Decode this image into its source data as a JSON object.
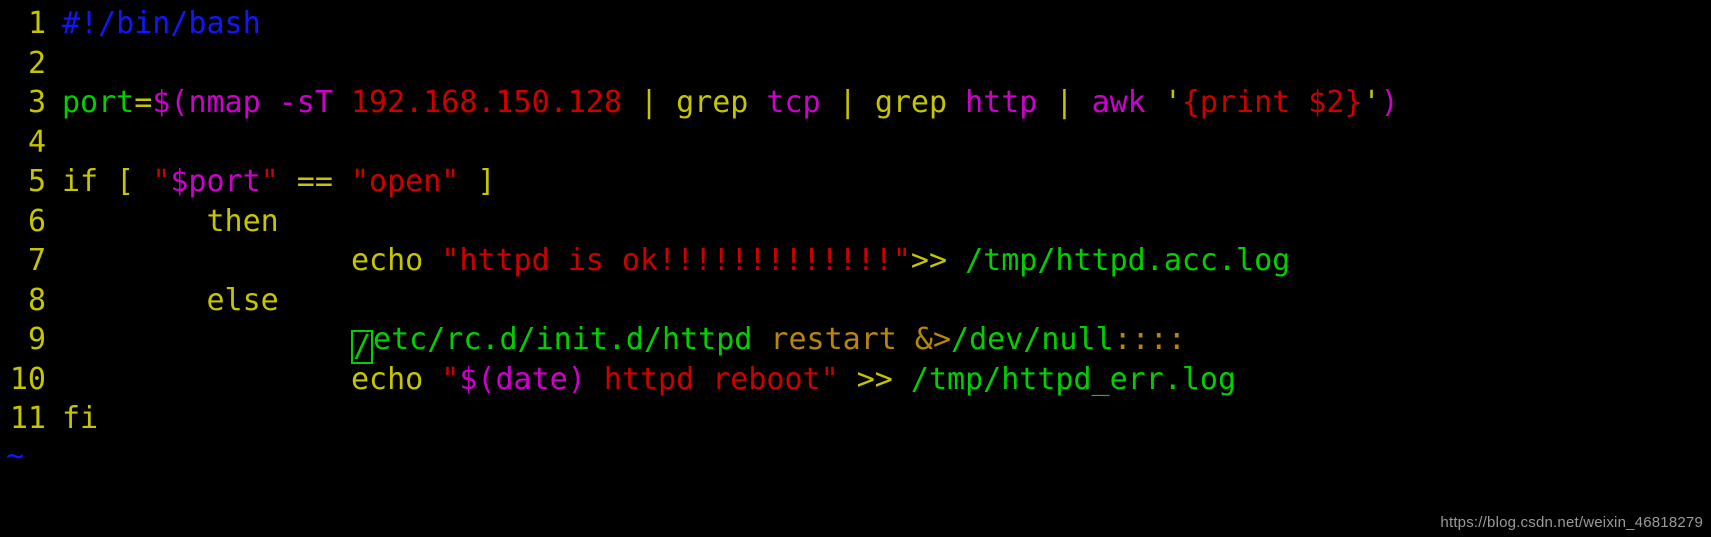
{
  "editor": {
    "name": "vim",
    "background_color": "#000000",
    "line_number_color": "#c5c500",
    "tilde_marker": "~",
    "cursor": {
      "style": "hollow-block",
      "color": "#00d000",
      "line": 9,
      "column": 1,
      "character": "/"
    }
  },
  "colors": {
    "comment_blue": "#1414ff",
    "keyword_yellow": "#c5c500",
    "variable_magenta": "#cd00cd",
    "string_red": "#cd0000",
    "path_green": "#00d000",
    "olive": "#b8860b",
    "line_number": "#c5c500",
    "watermark": "#9a9a9a"
  },
  "lines": [
    {
      "number": "1",
      "text": "#!/bin/bash"
    },
    {
      "number": "2",
      "text": ""
    },
    {
      "number": "3",
      "text": "port=$(nmap -sT 192.168.150.128 | grep tcp | grep http | awk '{print $2}')"
    },
    {
      "number": "4",
      "text": ""
    },
    {
      "number": "5",
      "text": "if [ \"$port\" == \"open\" ]"
    },
    {
      "number": "6",
      "text": "        then"
    },
    {
      "number": "7",
      "text": "                echo \"httpd is ok!!!!!!!!!!!!!\">> /tmp/httpd.acc.log"
    },
    {
      "number": "8",
      "text": "        else"
    },
    {
      "number": "9",
      "text": "                /etc/rc.d/init.d/httpd restart &>/dev/null::::"
    },
    {
      "number": "10",
      "text": "                echo \"$(date) httpd reboot\" >> /tmp/httpd_err.log"
    },
    {
      "number": "11",
      "text": "fi"
    }
  ],
  "tokens": {
    "l1": {
      "shebang": "#!/bin/bash"
    },
    "l3": {
      "var": "port",
      "eq": "=",
      "dollar_paren": "$(",
      "nmap": "nmap",
      "flag": " -sT ",
      "ip": "192.168.150.128",
      "pipe1": " | ",
      "grep1": "grep",
      "tcp": " tcp",
      "pipe2": " | ",
      "grep2": "grep",
      "http": " http",
      "pipe3": " | ",
      "awk": "awk",
      "space": " ",
      "quote_open": "'",
      "awk_body": "{print $2}",
      "quote_close": "'",
      "close_paren": ")"
    },
    "l5": {
      "if": "if",
      "bracket_open": " [ ",
      "quote1": "\"",
      "port_var": "$port",
      "quote2": "\"",
      "eqeq": " == ",
      "open_str": "\"open\"",
      "bracket_close": " ]"
    },
    "l6": {
      "indent": "        ",
      "then": "then"
    },
    "l7": {
      "indent": "                ",
      "echo": "echo",
      "space": " ",
      "string": "\"httpd is ok!!!!!!!!!!!!!\"",
      "redirect": ">>",
      "path": " /tmp/httpd.acc.log"
    },
    "l8": {
      "indent": "        ",
      "else": "else"
    },
    "l9": {
      "indent": "                ",
      "cursor_char": "/",
      "path": "etc/rc.d/init.d/httpd",
      "restart": " restart",
      "redirect": " &>",
      "devnull": "/dev/null",
      "colons": "::::"
    },
    "l10": {
      "indent": "                ",
      "echo": "echo",
      "space": " ",
      "quote_open": "\"",
      "date_sub": "$(date)",
      "msg": " httpd reboot\"",
      "redirect": " >> ",
      "path": "/tmp/httpd_err.log"
    },
    "l11": {
      "fi": "fi"
    }
  },
  "watermark": {
    "text": "https://blog.csdn.net/weixin_46818279"
  }
}
